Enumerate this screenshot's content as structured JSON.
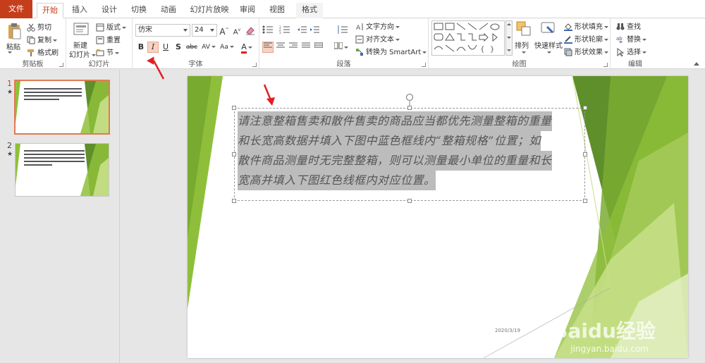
{
  "tabs": [
    {
      "label": "文件"
    },
    {
      "label": "开始"
    },
    {
      "label": "插入"
    },
    {
      "label": "设计"
    },
    {
      "label": "切换"
    },
    {
      "label": "动画"
    },
    {
      "label": "幻灯片放映"
    },
    {
      "label": "审阅"
    },
    {
      "label": "视图"
    },
    {
      "label": "格式"
    }
  ],
  "clipboard": {
    "paste": "粘贴",
    "cut": "剪切",
    "copy": "复制",
    "format_painter": "格式刷",
    "label": "剪贴板"
  },
  "slides_group": {
    "new_slide_1": "新建",
    "new_slide_2": "幻灯片",
    "layout": "版式",
    "reset": "重置",
    "section": "节",
    "label": "幻灯片"
  },
  "font": {
    "name": "仿宋",
    "size": "24",
    "bold": "B",
    "italic": "I",
    "underline": "U",
    "shadow": "S",
    "strike": "abc",
    "spacing": "AV",
    "case": "Aa",
    "color": "A",
    "grow": "A",
    "shrink": "A",
    "label": "字体"
  },
  "paragraph": {
    "text_direction": "文字方向",
    "align_text": "对齐文本",
    "smartart": "转换为 SmartArt",
    "label": "段落"
  },
  "drawing": {
    "arrange": "排列",
    "quick_styles": "快速样式",
    "shape_fill": "形状填充",
    "shape_outline": "形状轮廓",
    "shape_effects": "形状效果",
    "label": "绘图"
  },
  "editing": {
    "find": "查找",
    "replace": "替换",
    "select": "选择",
    "label": "编辑"
  },
  "thumbnails": [
    {
      "num": "1",
      "star": "★"
    },
    {
      "num": "2",
      "star": "★"
    }
  ],
  "slide": {
    "text_lines": [
      "请注意整箱售卖和散件售卖的商品应当都优先测量整箱的重量",
      "和长宽高数据并填入下图中蓝色框线内“整箱规格”位置；如",
      "散件商品测量时无完整整箱，则可以测量最小单位的重量和长",
      "宽高并填入下图红色线框内对应位置。"
    ],
    "date": "2020/3/19"
  },
  "watermark": {
    "main": "Baidu经验",
    "sub": "jingyan.baidu.com"
  },
  "colors": {
    "accent": "#c43e1c",
    "green_dark": "#5e8f2a",
    "green_mid": "#8fbf3a",
    "green_light": "#c8e08a"
  }
}
